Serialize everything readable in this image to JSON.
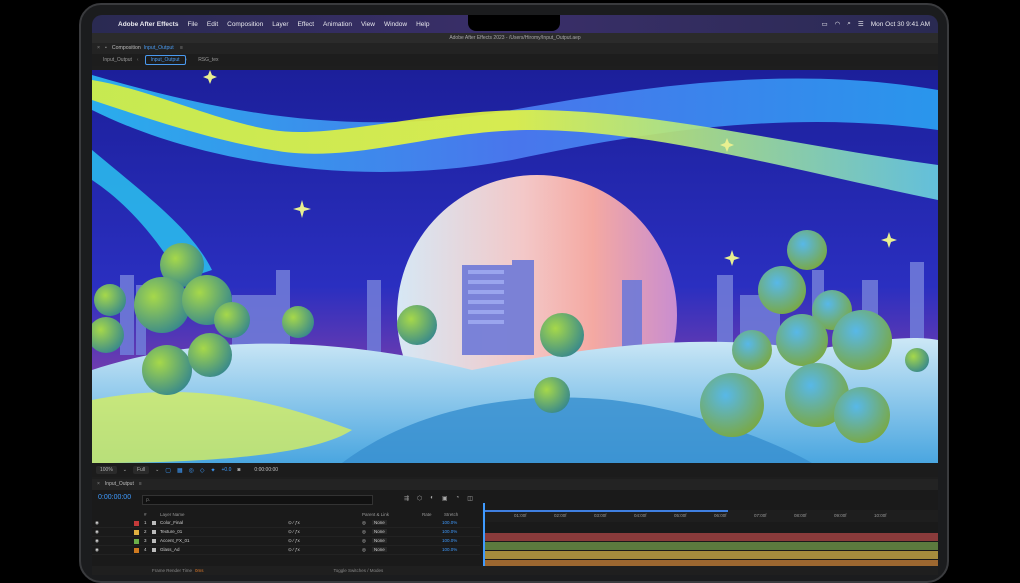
{
  "menubar": {
    "app_name": "Adobe After Effects",
    "items": [
      "File",
      "Edit",
      "Composition",
      "Layer",
      "Effect",
      "Animation",
      "View",
      "Window",
      "Help"
    ],
    "datetime": "Mon Oct 30  9:41 AM"
  },
  "window": {
    "title": "Adobe After Effects 2023 - /Users/Hiromy/Input_Output.aep"
  },
  "composition_panel": {
    "label": "Composition",
    "name": "Input_Output",
    "tabs": [
      "Input_Output",
      "Input_Output",
      "RSG_tex"
    ],
    "active_tab": 1
  },
  "viewer_toolbar": {
    "zoom": "100%",
    "resolution": "Full",
    "offset": "+0.0",
    "timecode": "0:00:00:00"
  },
  "timeline": {
    "panel_name": "Input_Output",
    "timecode": "0:00:00:00",
    "search_placeholder": "ρ.",
    "columns": {
      "layer_name": "Layer Name",
      "parent": "Parent & Link",
      "stretch": "Stretch",
      "num": "#",
      "rate": "Rate"
    },
    "ruler": [
      "01:00f",
      "02:00f",
      "03:00f",
      "04:00f",
      "05:00f",
      "06:00f",
      "07:00f",
      "08:00f",
      "09:00f",
      "10:00f"
    ],
    "layers": [
      {
        "num": "1",
        "name": "Color_Final",
        "color": "#c43a3a",
        "parent": "None",
        "stretch": "100.0%",
        "track": "#8a3b3b"
      },
      {
        "num": "2",
        "name": "Texture_01",
        "color": "#e0b040",
        "parent": "None",
        "stretch": "100.0%",
        "track": "#5c7a3e"
      },
      {
        "num": "3",
        "name": "Accent_FX_01",
        "color": "#6cb04a",
        "parent": "None",
        "stretch": "100.0%",
        "track": "#a58c3d"
      },
      {
        "num": "4",
        "name": "Glass_Ad",
        "color": "#d07a20",
        "parent": "None",
        "stretch": "100.0%",
        "track": "#9c6730"
      }
    ],
    "footer": {
      "render_label": "Frame Render Time",
      "render_value": "0ms",
      "toggle": "Toggle Switches / Modes"
    }
  }
}
